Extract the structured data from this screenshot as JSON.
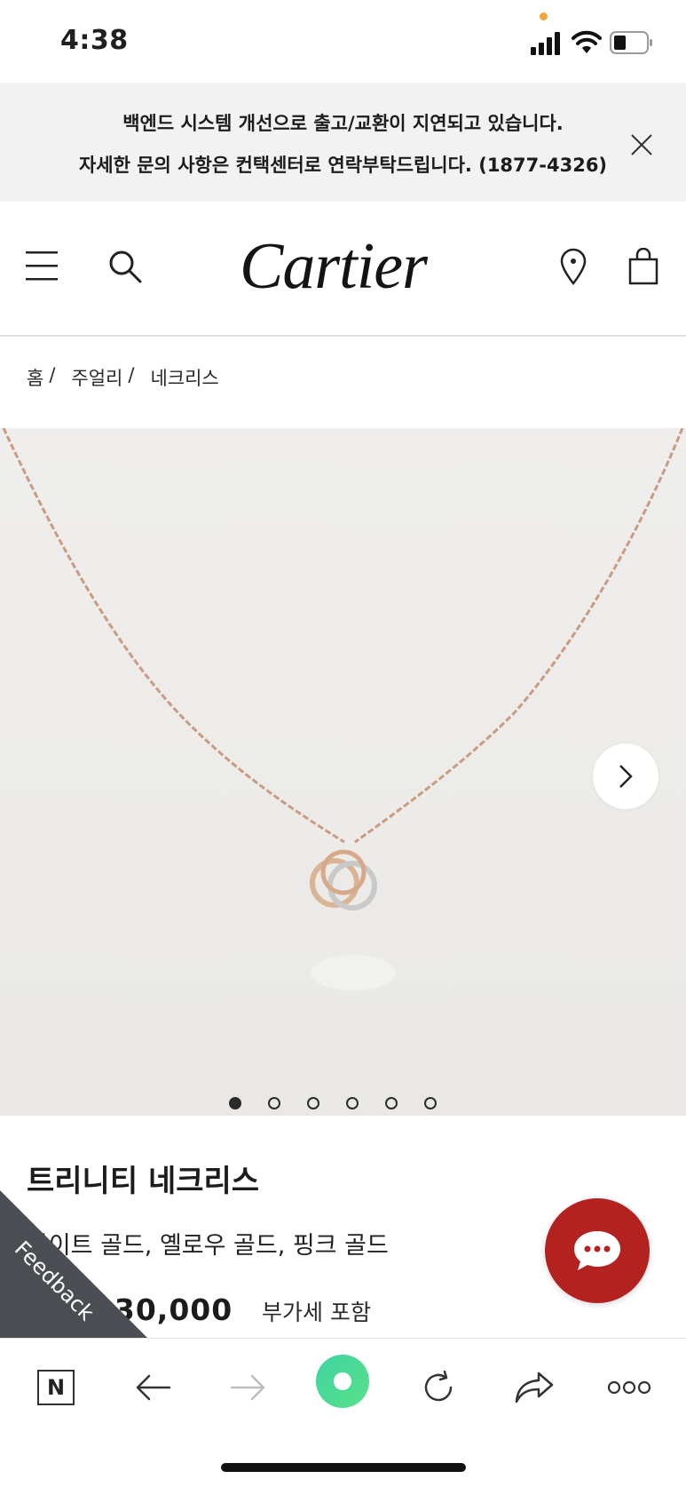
{
  "status_bar": {
    "time": "4:38"
  },
  "notice": {
    "line1": "백엔드 시스템 개선으로 출고/교환이 지연되고 있습니다.",
    "line2": "자세한 문의 사항은 컨택센터로 연락부탁드립니다. (1877-4326)"
  },
  "header": {
    "logo": "Cartier"
  },
  "breadcrumb": {
    "items": [
      "홈",
      "주얼리",
      "네크리스"
    ],
    "separator": "/"
  },
  "gallery": {
    "slide_count": 6,
    "active_index": 0
  },
  "product": {
    "title": "트리니티 네크리스",
    "material": "화이트 골드, 옐로우 골드, 핑크 골드",
    "price_visible": "30,000",
    "vat_note": "부가세 포함"
  },
  "feedback": {
    "label": "Feedback"
  },
  "browser_toolbar": {
    "brand_letter": "N"
  },
  "colors": {
    "notice_bg": "#f2f2f2",
    "chat_button": "#b3221f",
    "feedback_ribbon": "#4a4d51",
    "browser_accent": "#3fd48a"
  }
}
